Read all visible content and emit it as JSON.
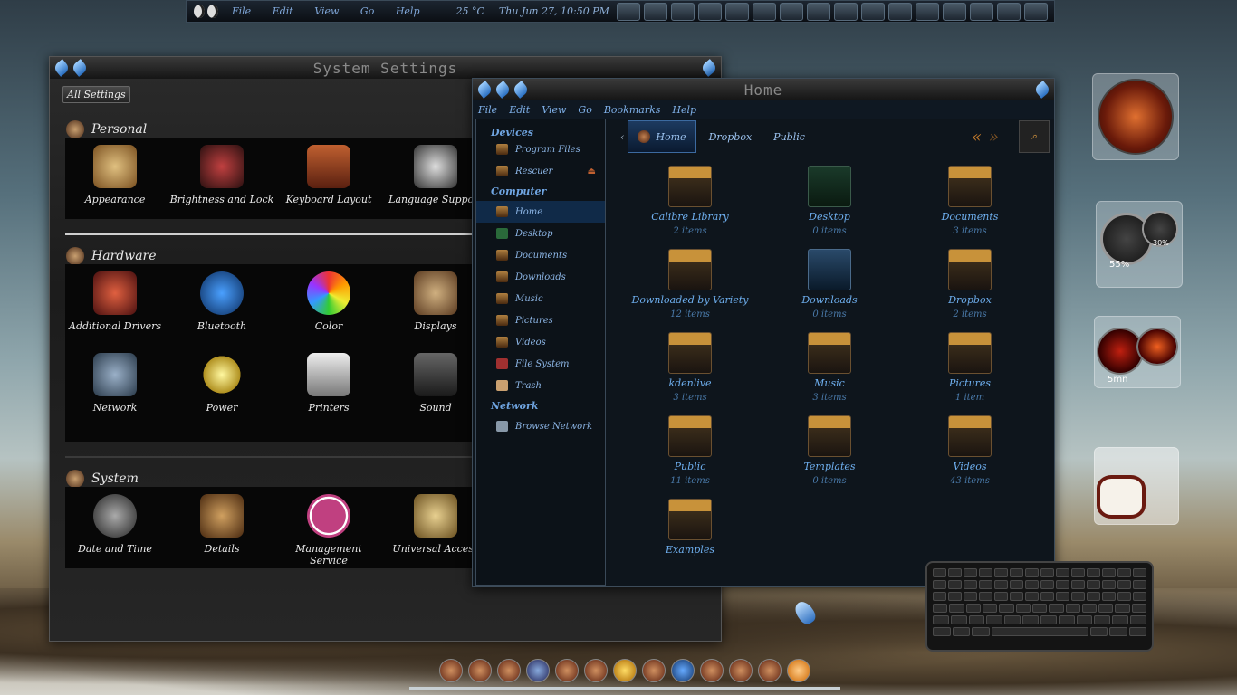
{
  "topbar": {
    "menu": [
      "File",
      "Edit",
      "View",
      "Go",
      "Help"
    ],
    "weather": "25 °C",
    "datetime": "Thu Jun 27, 10:50 PM"
  },
  "settings": {
    "title": "System Settings",
    "all_settings": "All Settings",
    "sections": [
      {
        "name": "Personal",
        "items": [
          "Appearance",
          "Brightness and Lock",
          "Keyboard Layout",
          "Language Support"
        ]
      },
      {
        "name": "Hardware",
        "items": [
          "Additional Drivers",
          "Bluetooth",
          "Color",
          "Displays",
          "Network",
          "Power",
          "Printers",
          "Sound"
        ]
      },
      {
        "name": "System",
        "items": [
          "Date and Time",
          "Details",
          "Management Service",
          "Universal Access"
        ]
      }
    ]
  },
  "files": {
    "title": "Home",
    "menu": [
      "File",
      "Edit",
      "View",
      "Go",
      "Bookmarks",
      "Help"
    ],
    "sidebar": {
      "devices_label": "Devices",
      "devices": [
        "Program Files",
        "Rescuer"
      ],
      "computer_label": "Computer",
      "computer": [
        "Home",
        "Desktop",
        "Documents",
        "Downloads",
        "Music",
        "Pictures",
        "Videos",
        "File System",
        "Trash"
      ],
      "network_label": "Network",
      "network": [
        "Browse Network"
      ]
    },
    "path": [
      "Home",
      "Dropbox",
      "Public"
    ],
    "items": [
      {
        "name": "Calibre Library",
        "count": "2 items"
      },
      {
        "name": "Desktop",
        "count": "0 items"
      },
      {
        "name": "Documents",
        "count": "3 items"
      },
      {
        "name": "Downloaded by Variety",
        "count": "12 items"
      },
      {
        "name": "Downloads",
        "count": "0 items"
      },
      {
        "name": "Dropbox",
        "count": "2 items"
      },
      {
        "name": "kdenlive",
        "count": "3 items"
      },
      {
        "name": "Music",
        "count": "3 items"
      },
      {
        "name": "Pictures",
        "count": "1 item"
      },
      {
        "name": "Public",
        "count": "11 items"
      },
      {
        "name": "Templates",
        "count": "0 items"
      },
      {
        "name": "Videos",
        "count": "43 items"
      },
      {
        "name": "Examples",
        "count": ""
      }
    ]
  },
  "gadgets": {
    "cpu": "55%",
    "ram": "30%",
    "timer": "5mn"
  }
}
